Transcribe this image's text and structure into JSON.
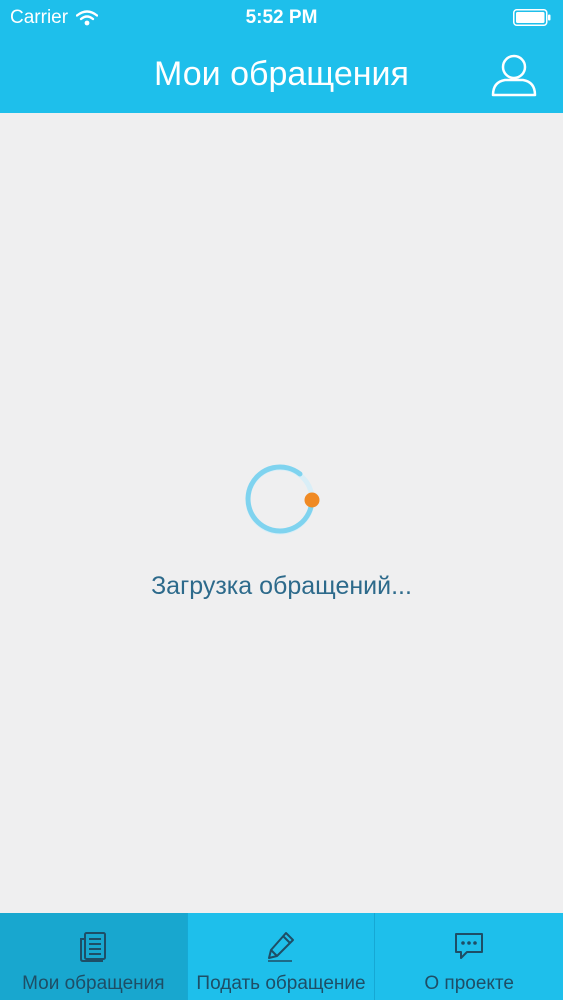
{
  "status_bar": {
    "carrier": "Carrier",
    "time": "5:52 PM",
    "wifi_icon": "wifi-icon",
    "battery_icon": "battery-icon"
  },
  "header": {
    "title": "Мои обращения",
    "profile_icon": "user-icon"
  },
  "main": {
    "loading_text": "Загрузка обращений...",
    "spinner_icon": "loading-spinner"
  },
  "tabbar": {
    "tabs": [
      {
        "label": "Мои обращения",
        "icon": "document-list-icon",
        "selected": true
      },
      {
        "label": "Подать обращение",
        "icon": "pencil-icon",
        "selected": false
      },
      {
        "label": "О проекте",
        "icon": "chat-bubble-icon",
        "selected": false
      }
    ]
  },
  "colors": {
    "accent": "#1ebfeb",
    "active_tab": "#18a7cf",
    "background": "#efeff0",
    "loading_text": "#2d6a8b",
    "spinner_dot": "#f08a24"
  }
}
